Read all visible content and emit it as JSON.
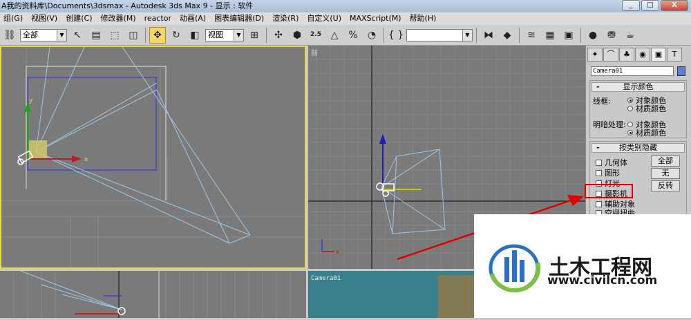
{
  "window": {
    "title": "A我的资料库\\Documents\\3dsmax      - Autodesk 3ds Max 9      - 显示 : 软件",
    "btn_min": "_",
    "btn_max": "□",
    "btn_close": "X"
  },
  "menu": [
    "组(G)",
    "视图(V)",
    "创建(C)",
    "修改器(M)",
    "reactor",
    "动画(A)",
    "图表编辑器(D)",
    "渲染(R)",
    "自定义(U)",
    "MAXScript(M)",
    "帮助(H)"
  ],
  "toolbar": {
    "selection_filter": "全部",
    "ref_coord": "视图",
    "named_selection": "",
    "snap_label": "2.5"
  },
  "viewports": {
    "top_right_label": "前",
    "bottom_right_label": "Camera01"
  },
  "command_panel": {
    "object_name": "Camera01",
    "object_color": "#5a7fd6",
    "display_color": {
      "header": "显示颜色",
      "wireframe_label": "线框:",
      "wireframe_opt1": "对象颜色",
      "wireframe_opt2": "材质颜色",
      "shaded_label": "明暗处理:",
      "shaded_opt1": "对象颜色",
      "shaded_opt2": "材质颜色"
    },
    "hide_by_category": {
      "header": "按类别隐藏",
      "items": [
        "几何体",
        "图形",
        "灯光",
        "摄影机",
        "辅助对象",
        "空间扭曲"
      ],
      "btn_all": "全部",
      "btn_none": "无",
      "btn_invert": "反转"
    }
  },
  "watermark": {
    "brand": "土木工程网",
    "url": "www.civilcn.com"
  }
}
